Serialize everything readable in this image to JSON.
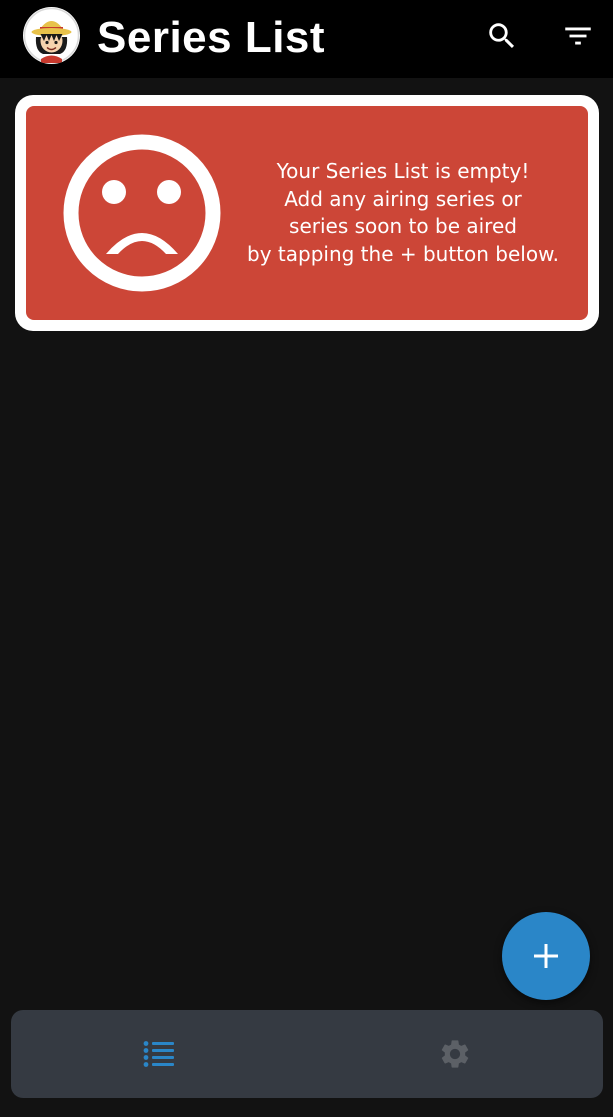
{
  "app_bar": {
    "title": "Series List",
    "avatar_icon": "straw-hat-character-avatar",
    "search_icon": "search-icon",
    "filter_icon": "filter-icon",
    "background": "#000000"
  },
  "empty_state": {
    "icon": "sad-face-icon",
    "lines": [
      "Your Series List is empty!",
      "Add any airing series or",
      "series soon to be aired",
      "by tapping the + button below."
    ],
    "card_color": "#cc4637",
    "border_color": "#ffffff"
  },
  "fab": {
    "icon": "plus-icon",
    "color": "#2a86c8"
  },
  "bottom_nav": {
    "items": [
      {
        "icon": "list-icon",
        "active": true,
        "color": "#2a86c8"
      },
      {
        "icon": "settings-icon",
        "active": false,
        "color": "#5c6066"
      }
    ],
    "background": "#353a42"
  },
  "background": "#121212"
}
